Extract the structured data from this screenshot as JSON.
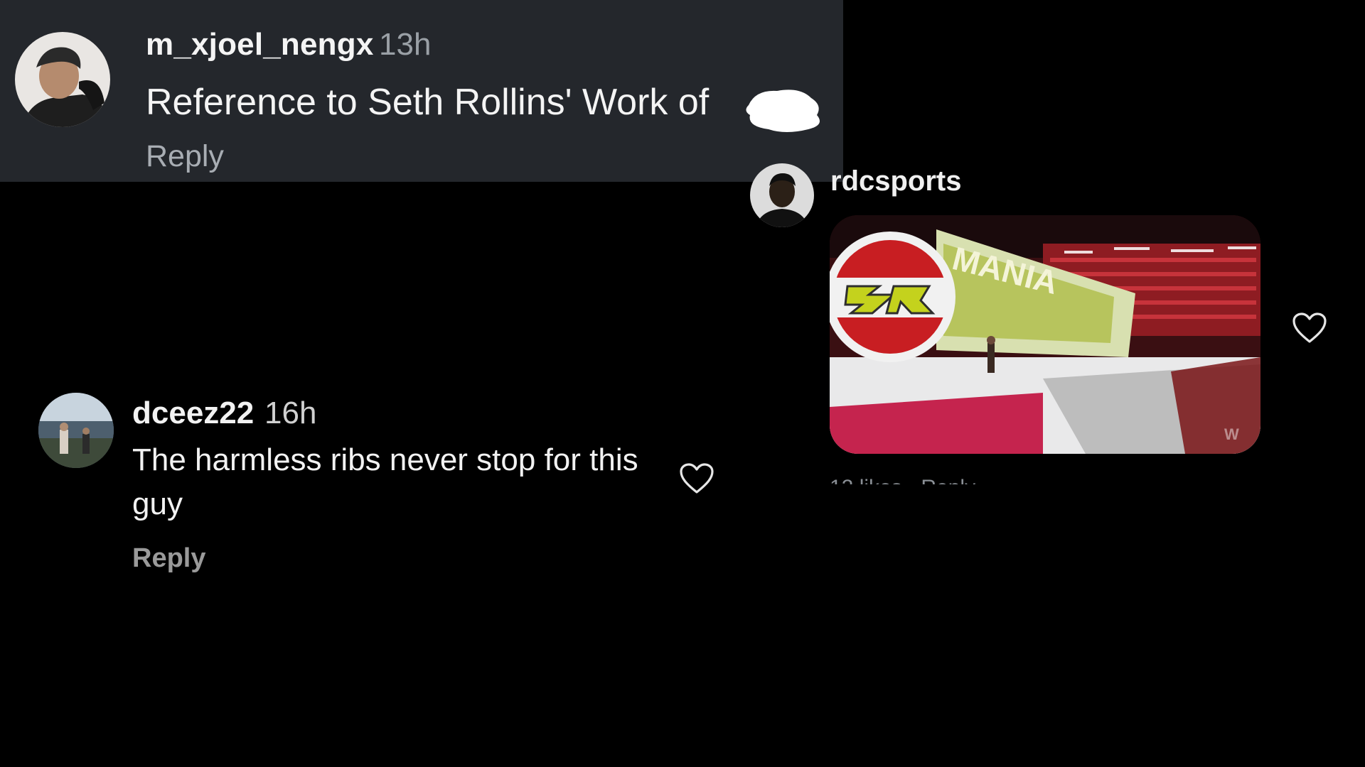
{
  "comments": [
    {
      "username": "m_xjoel_nengx",
      "time": "13h",
      "text": "Reference to Seth Rollins' Work of",
      "reply_label": "Reply",
      "avatar_icon": "user-avatar-photo"
    },
    {
      "username": "rdcsports",
      "media": "Seth Rollins WrestleMania entrance GIF",
      "avatar_icon": "user-avatar-photo",
      "like_icon": "heart-outline-icon"
    },
    {
      "username": "dceez22",
      "time": "16h",
      "text": "The harmless ribs never stop for this guy",
      "reply_label": "Reply",
      "avatar_icon": "user-avatar-photo",
      "like_icon": "heart-outline-icon"
    }
  ],
  "colors": {
    "page_background": "#000000",
    "card_background": "#24272c",
    "muted_text": "#9aa0a6"
  }
}
